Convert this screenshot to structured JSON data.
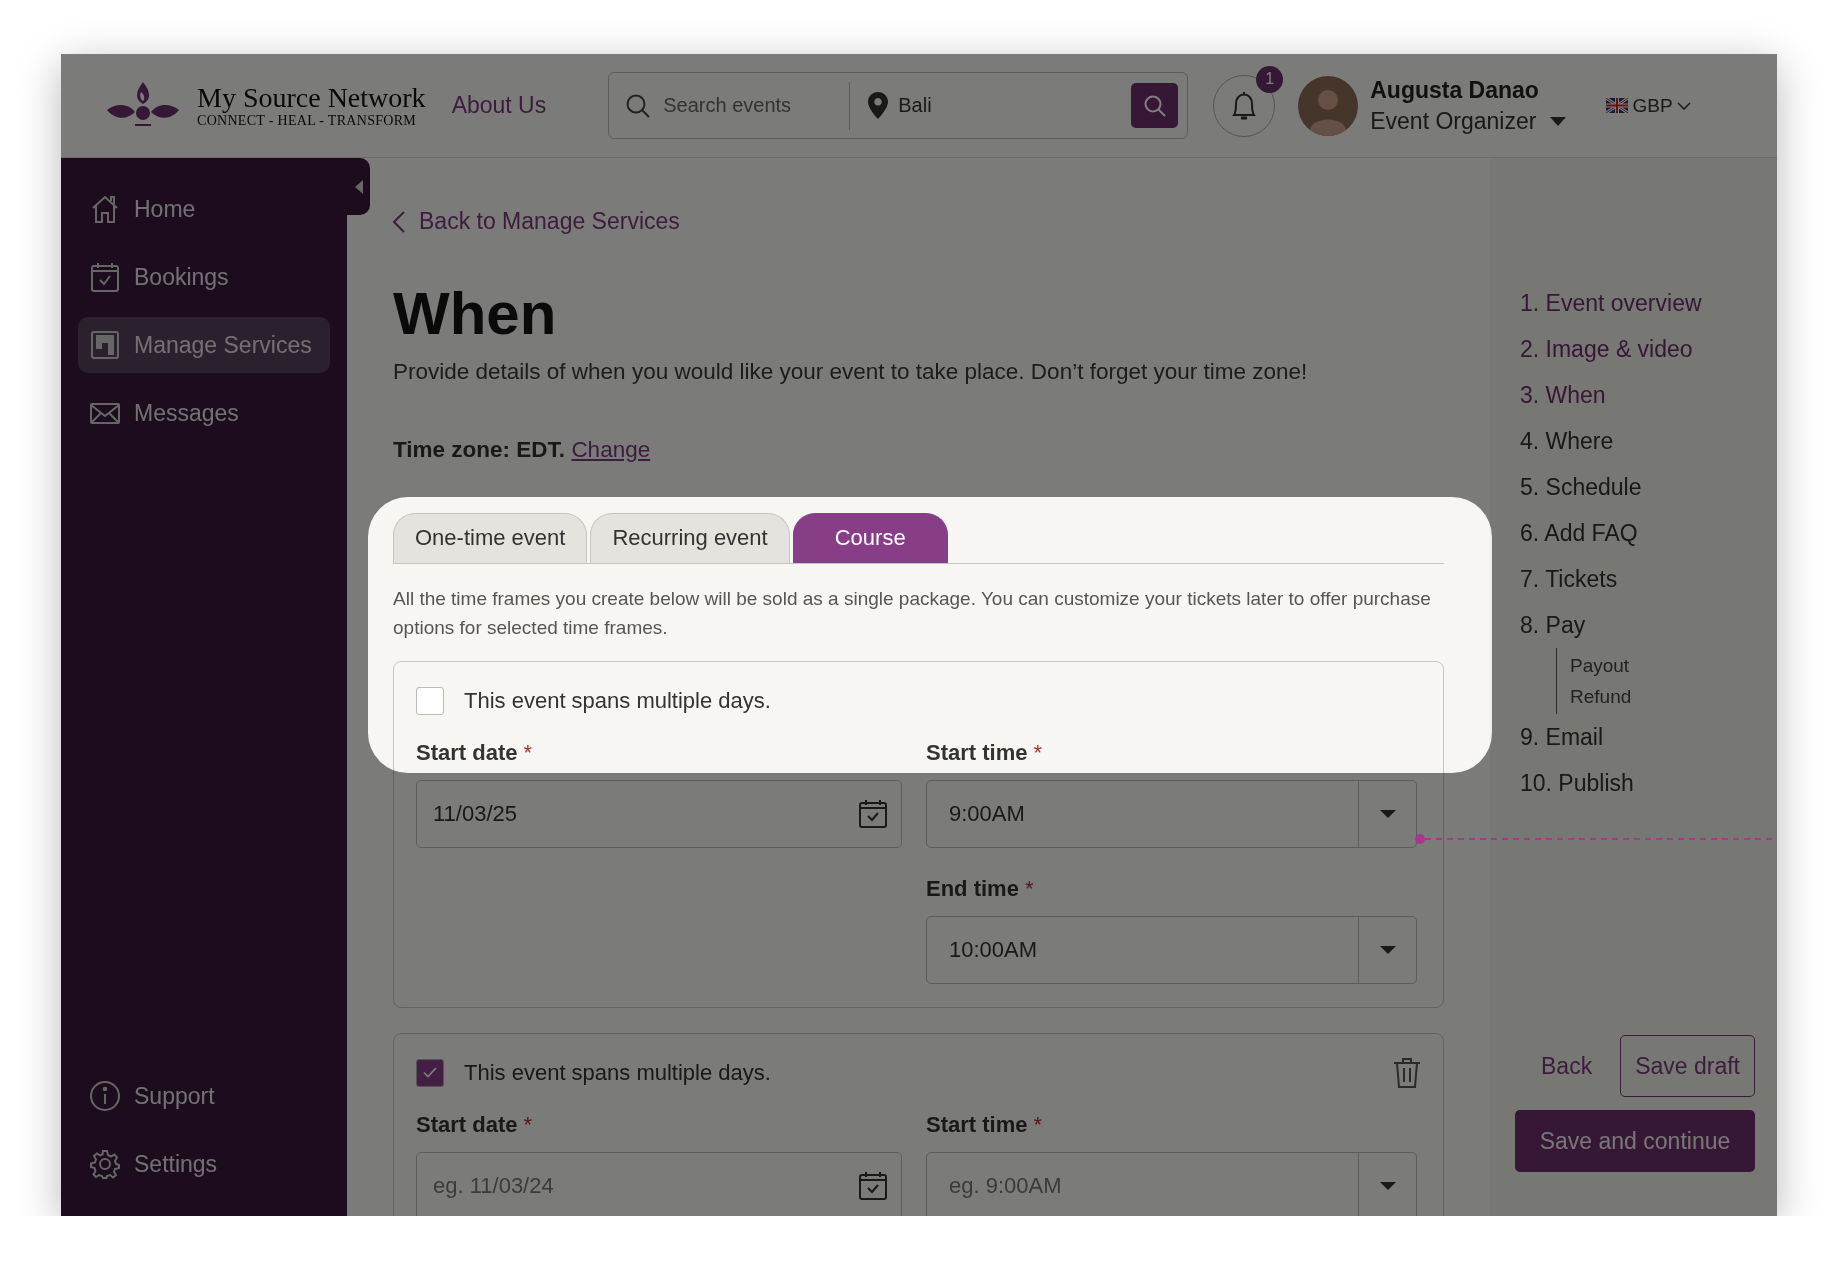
{
  "header": {
    "logo": {
      "title": "My Source Network",
      "tagline": "CONNECT - HEAL - TRANSFORM"
    },
    "about_link": "About Us",
    "search": {
      "placeholder": "Search events",
      "location": "Bali"
    },
    "notifications": {
      "count": "1"
    },
    "user": {
      "name": "Augusta Danao",
      "role": "Event Organizer"
    },
    "currency": "GBP"
  },
  "sidebar": {
    "items": [
      {
        "label": "Home",
        "selected": false
      },
      {
        "label": "Bookings",
        "selected": false
      },
      {
        "label": "Manage Services",
        "selected": true
      },
      {
        "label": "Messages",
        "selected": false
      }
    ],
    "bottom_items": [
      {
        "label": "Support"
      },
      {
        "label": "Settings"
      }
    ]
  },
  "back_link": "Back to Manage Services",
  "title": "When",
  "description": "Provide details of when you would like your event to take place. Don’t forget your time zone!",
  "time_zone": {
    "label": "Time zone: EDT.",
    "link": "Change"
  },
  "tabs": [
    {
      "label": "One-time event",
      "selected": false
    },
    {
      "label": "Recurring event",
      "selected": false
    },
    {
      "label": "Course",
      "selected": true
    }
  ],
  "tab_note": "All the time frames you create below will be sold as a single package. You can customize your tickets later to offer purchase options for selected time frames.",
  "time_frames": [
    {
      "multi_day": false,
      "label": "This event spans multiple days.",
      "deletable": false,
      "fields": [
        {
          "kind": "date",
          "label": "Start date",
          "required_mark": "*",
          "value": "11/03/25"
        },
        {
          "kind": "time",
          "label": "Start time",
          "required_mark": "*",
          "value": "9:00AM"
        },
        {
          "kind": "empty"
        },
        {
          "kind": "time",
          "label": "End time",
          "required_mark": "*",
          "value": "10:00AM"
        }
      ]
    },
    {
      "multi_day": true,
      "label": "This event spans multiple days.",
      "deletable": true,
      "fields": [
        {
          "kind": "date",
          "label": "Start date",
          "required_mark": "*",
          "placeholder": "eg. 11/03/24"
        },
        {
          "kind": "time",
          "label": "Start time",
          "required_mark": "*",
          "placeholder": "eg. 9:00AM"
        }
      ]
    }
  ],
  "steps": [
    {
      "label": "1. Event overview",
      "done": true
    },
    {
      "label": "2. Image & video",
      "done": true
    },
    {
      "label": "3. When",
      "done": true
    },
    {
      "label": "4. Where",
      "done": false
    },
    {
      "label": "5. Schedule",
      "done": false
    },
    {
      "label": "6. Add FAQ",
      "done": false
    },
    {
      "label": "7. Tickets",
      "done": false
    },
    {
      "label": "8. Pay",
      "done": false,
      "children": [
        {
          "label": "Payout"
        },
        {
          "label": "Refund"
        }
      ]
    },
    {
      "label": "9. Email",
      "done": false
    },
    {
      "label": "10. Publish",
      "done": false
    }
  ],
  "actions": {
    "back": "Back",
    "save_draft": "Save draft",
    "save_continue": "Save and continue"
  }
}
